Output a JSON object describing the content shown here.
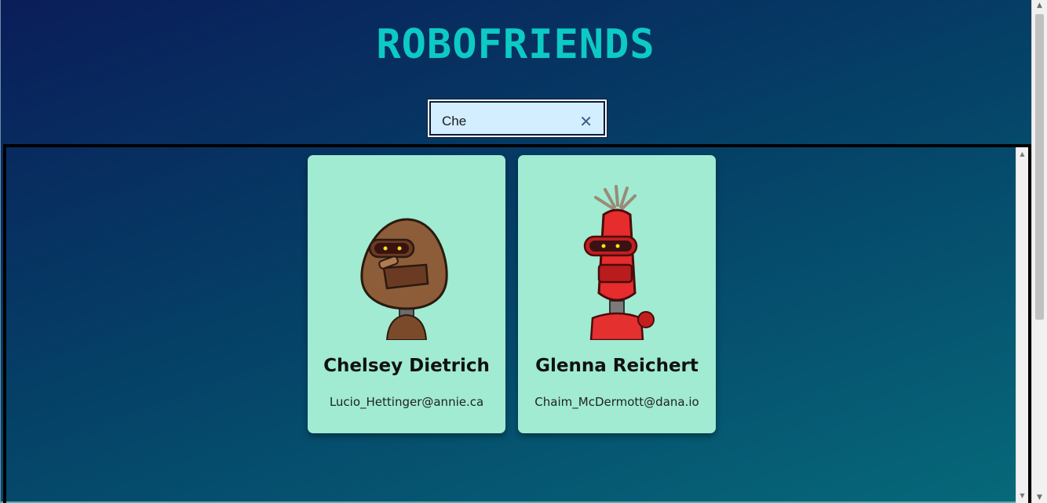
{
  "header": {
    "title": "RoboFriends"
  },
  "search": {
    "value": "Che",
    "clear_icon": "close-icon"
  },
  "robots": [
    {
      "name": "Chelsey Dietrich",
      "email": "Lucio_Hettinger@annie.ca",
      "color": "#8a5a3a"
    },
    {
      "name": "Glenna Reichert",
      "email": "Chaim_McDermott@dana.io",
      "color": "#e53030"
    }
  ],
  "colors": {
    "accent": "#0ccac4",
    "card": "#a0ebd2",
    "search_bg": "#d3eefe"
  }
}
